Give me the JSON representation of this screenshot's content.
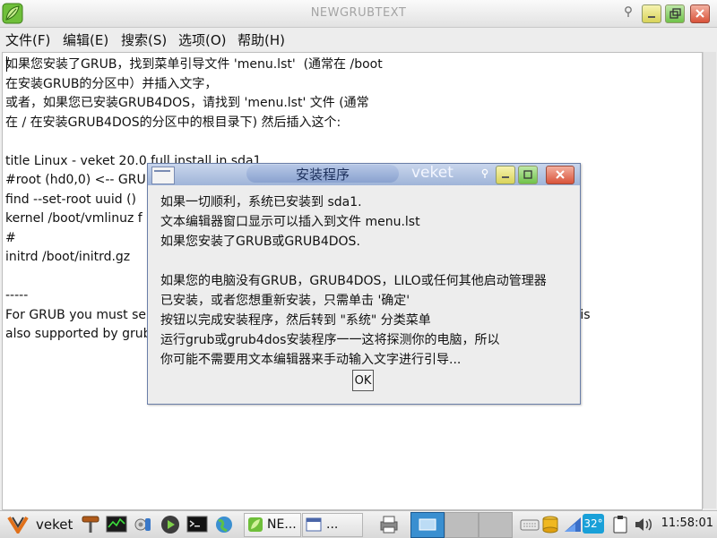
{
  "window": {
    "title": "NEWGRUBTEXT"
  },
  "menu": [
    {
      "label": "文件(F)"
    },
    {
      "label": "编辑(E)"
    },
    {
      "label": "搜索(S)"
    },
    {
      "label": "选项(O)"
    },
    {
      "label": "帮助(H)"
    }
  ],
  "editor": {
    "text": "如果您安装了GRUB，找到菜单引导文件 'menu.lst'  (通常在 /boot\n在安装GRUB的分区中）并插入文字，\n或者，如果您已安装GRUB4DOS，请找到 'menu.lst' 文件 (通常\n在 / 在安装GRUB4DOS的分区中的根目录下) 然后插入这个:\n\ntitle Linux - veket 20.0 full install in sda1\n#root (hd0,0) <-- GRUB\nfind --set-root uuid ()                                                                                                         \nkernel /boot/vmlinuz f                                                                                             atahd\n#\ninitrd /boot/initrd.gz\n\n-----\nFor GRUB you must se                                                                                          oot (hdX,X) is\nalso supported by grub"
  },
  "dialog": {
    "title": "安装程序",
    "host": "veket",
    "body": "如果一切顺利，系统已安装到 sda1.\n文本编辑器窗口显示可以插入到文件 menu.lst\n如果您安装了GRUB或GRUB4DOS.\n\n如果您的电脑没有GRUB，GRUB4DOS，LILO或任何其他启动管理器\n已安装，或者您想重新安装，只需单击 '确定'\n按钮以完成安装程序，然后转到 \"系统\" 分类菜单\n运行grub或grub4dos安装程序一一这将探测你的电脑，所以\n你可能不需要用文本编辑器来手动输入文字进行引导...",
    "ok_label": "OK"
  },
  "taskbar": {
    "start_label": "veket",
    "tasks": [
      {
        "label": "NE...",
        "icon": "editor-icon"
      },
      {
        "label": "...",
        "icon": "dialog-window-icon"
      }
    ],
    "temperature": "32°",
    "clock": "11:58:01"
  },
  "colors": {
    "dialog_title_bar": "#9fb4d8",
    "taskbar_active": "#3a8fd0",
    "temp_badge": "#19a0d8"
  }
}
